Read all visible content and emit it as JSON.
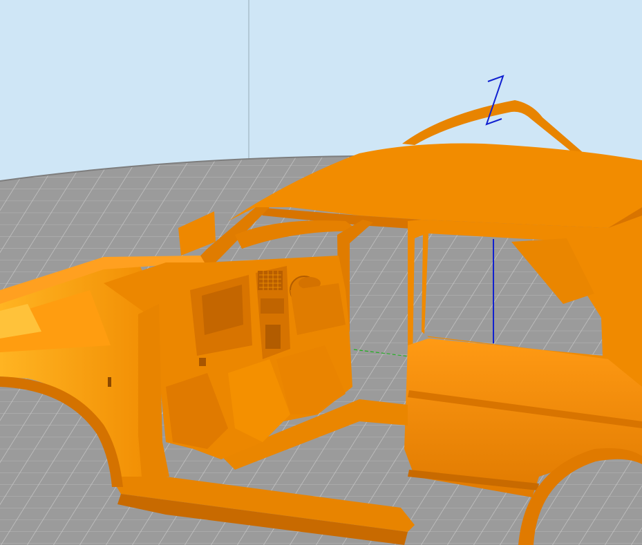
{
  "viewport": {
    "background_color": "#cfe6f6",
    "bed_color": "#9b9b9b",
    "grid_color": "#c8c8c8",
    "model_color": "#f08a00",
    "model_shadow_color": "#c86a00",
    "model_highlight_color": "#ffae33"
  },
  "axes": {
    "z_label": "Z",
    "x_color": "#e02020",
    "y_color": "#20b020",
    "z_color": "#1020d0"
  }
}
